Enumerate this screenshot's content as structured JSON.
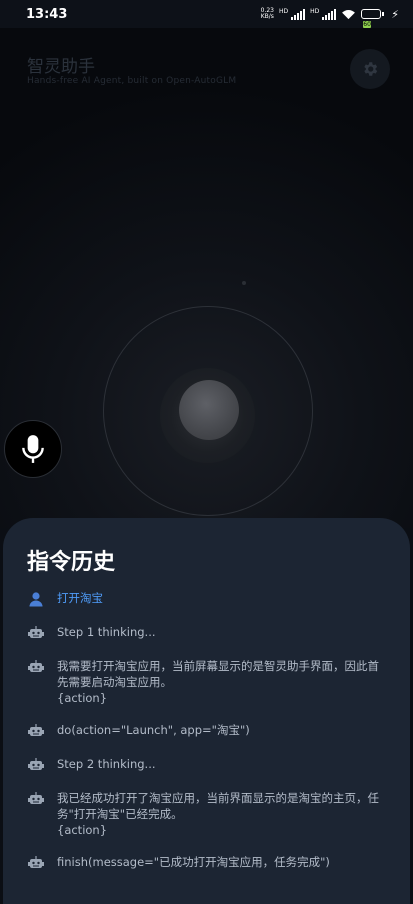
{
  "status_bar": {
    "time": "13:43",
    "net_speed": "0.23\nKB/s",
    "signal_label_1": "HD",
    "signal_label_2": "HD",
    "battery": "60"
  },
  "header": {
    "title": "智灵助手",
    "subtitle": "Hands-free AI Agent, built on Open-AutoGLM"
  },
  "history": {
    "title": "指令历史",
    "items": [
      {
        "role": "user",
        "icon": "user-icon",
        "text": "打开淘宝"
      },
      {
        "role": "agent",
        "icon": "robot-icon",
        "text": "Step 1 thinking..."
      },
      {
        "role": "agent",
        "icon": "robot-icon",
        "text": "我需要打开淘宝应用，当前屏幕显示的是智灵助手界面，因此首先需要启动淘宝应用。\n{action}"
      },
      {
        "role": "agent",
        "icon": "robot-icon",
        "text": "do(action=\"Launch\", app=\"淘宝\")"
      },
      {
        "role": "agent",
        "icon": "robot-icon",
        "text": "Step 2 thinking..."
      },
      {
        "role": "agent",
        "icon": "robot-icon",
        "text": "我已经成功打开了淘宝应用，当前界面显示的是淘宝的主页，任务\"打开淘宝\"已经完成。\n{action}"
      },
      {
        "role": "agent",
        "icon": "robot-icon",
        "text": "finish(message=\"已成功打开淘宝应用，任务完成\")"
      }
    ]
  },
  "colors": {
    "sheet_bg": "#1c2533",
    "user_accent": "#4f9cf9",
    "text_muted": "#b3bcc9",
    "page_bg": "#0b0e14"
  }
}
